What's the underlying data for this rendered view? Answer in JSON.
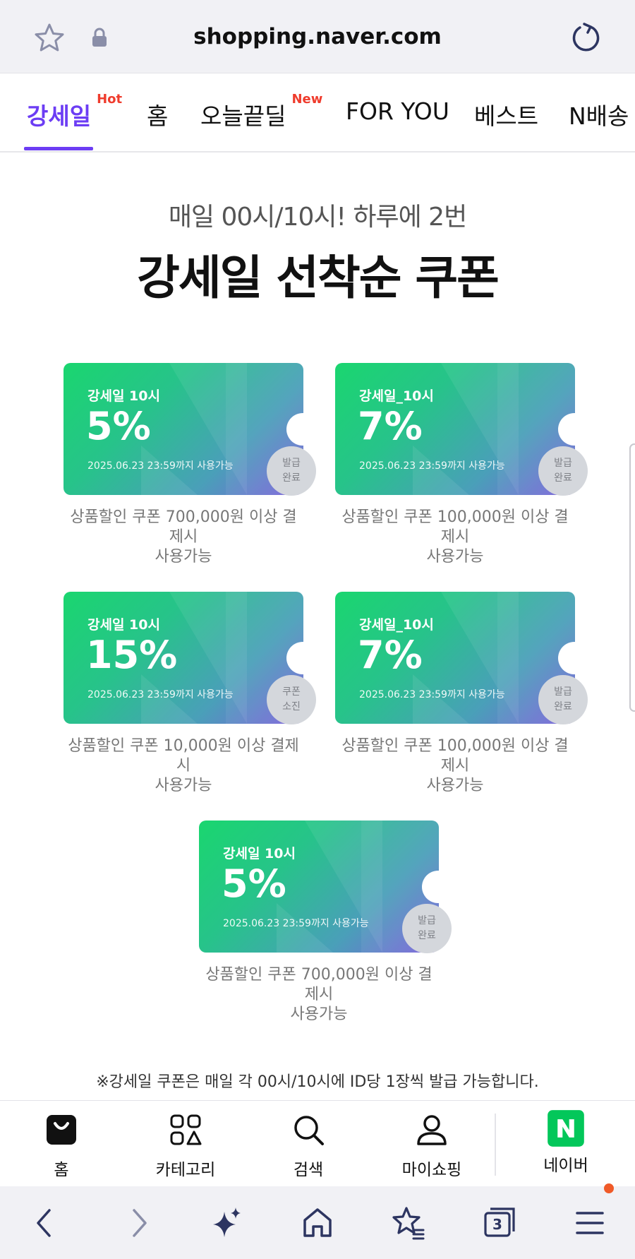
{
  "browser": {
    "url": "shopping.naver.com",
    "icons": [
      "star-icon",
      "lock-icon",
      "reload-icon"
    ]
  },
  "tabs": [
    {
      "label": "강세일",
      "badge": "Hot"
    },
    {
      "label": "홈"
    },
    {
      "label": "오늘끝딜",
      "badge": "New"
    },
    {
      "label": "FOR YOU"
    },
    {
      "label": "베스트"
    },
    {
      "label": "N배송"
    }
  ],
  "event": {
    "subtitle": "매일 00시/10시! 하루에 2번",
    "title": "강세일 선착순 쿠폰"
  },
  "coupons": [
    {
      "name": "강세일 10시",
      "percent": "5%",
      "expiry": "2025.06.23 23:59까지 사용가능",
      "status_line1": "발급",
      "status_line2": "완료",
      "desc_line1": "상품할인 쿠폰 700,000원 이상 결제시",
      "desc_line2": "사용가능"
    },
    {
      "name": "강세일_10시",
      "percent": "7%",
      "expiry": "2025.06.23 23:59까지 사용가능",
      "status_line1": "발급",
      "status_line2": "완료",
      "desc_line1": "상품할인 쿠폰 100,000원 이상 결제시",
      "desc_line2": "사용가능"
    },
    {
      "name": "강세일 10시",
      "percent": "15%",
      "expiry": "2025.06.23 23:59까지 사용가능",
      "status_line1": "쿠폰",
      "status_line2": "소진",
      "desc_line1": "상품할인 쿠폰 10,000원 이상 결제시",
      "desc_line2": "사용가능"
    },
    {
      "name": "강세일_10시",
      "percent": "7%",
      "expiry": "2025.06.23 23:59까지 사용가능",
      "status_line1": "발급",
      "status_line2": "완료",
      "desc_line1": "상품할인 쿠폰 100,000원 이상 결제시",
      "desc_line2": "사용가능"
    },
    {
      "name": "강세일 10시",
      "percent": "5%",
      "expiry": "2025.06.23 23:59까지 사용가능",
      "status_line1": "발급",
      "status_line2": "완료",
      "desc_line1": "상품할인 쿠폰 700,000원 이상 결제시",
      "desc_line2": "사용가능"
    }
  ],
  "notice": {
    "line1": "※강세일 쿠폰은 매일 각 00시/10시에 ID당 1장씩 발급 가능합니다."
  },
  "bottom_nav": [
    {
      "label": "홈",
      "icon": "shopping-bag-icon"
    },
    {
      "label": "카테고리",
      "icon": "category-icon"
    },
    {
      "label": "검색",
      "icon": "search-icon"
    },
    {
      "label": "마이쇼핑",
      "icon": "person-icon"
    },
    {
      "label": "네이버",
      "icon": "naver-logo-icon",
      "logo_letter": "N"
    }
  ],
  "toolbar": {
    "tab_count": "3",
    "icons": [
      "back-icon",
      "forward-icon",
      "sparkle-icon",
      "home-icon",
      "bookmark-star-icon",
      "tabs-icon",
      "menu-icon"
    ]
  },
  "colors": {
    "accent": "#6c3df4",
    "badge": "#ef3c2d",
    "coupon_start": "#1ad66f",
    "coupon_end": "#7e5fdc",
    "naver_green": "#03c75a"
  }
}
